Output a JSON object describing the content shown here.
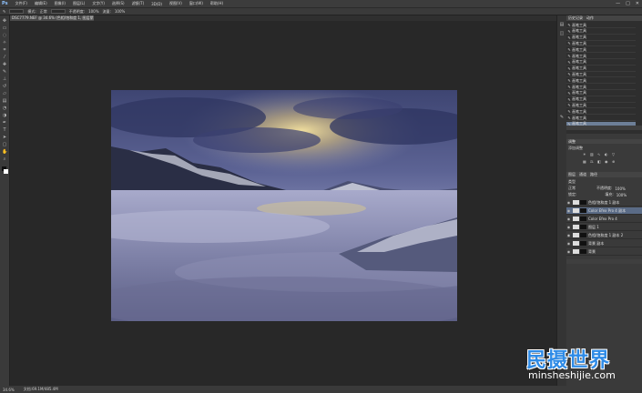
{
  "app": {
    "logo": "Ps",
    "menu": [
      "文件(F)",
      "编辑(E)",
      "图像(I)",
      "图层(L)",
      "文字(Y)",
      "选择(S)",
      "滤镜(T)",
      "3D(D)",
      "视图(V)",
      "窗口(W)",
      "帮助(H)"
    ],
    "window_controls": [
      "—",
      "□",
      "✕"
    ]
  },
  "options_bar": {
    "mode_label": "模式:",
    "mode_value": "正常",
    "opacity_label": "不透明度:",
    "opacity_value": "100%",
    "flow_label": "流量:",
    "flow_value": "100%"
  },
  "document_tab": {
    "title": "DSC7779.NEF @ 34.6% (色相/饱和度 1, 图层蒙版/8) *"
  },
  "history_panel": {
    "tabs": [
      "历史记录",
      "动作"
    ],
    "items": [
      "画笔工具",
      "画笔工具",
      "画笔工具",
      "画笔工具",
      "画笔工具",
      "画笔工具",
      "画笔工具",
      "画笔工具",
      "画笔工具",
      "画笔工具",
      "画笔工具",
      "画笔工具",
      "画笔工具",
      "画笔工具",
      "画笔工具",
      "画笔工具",
      "画笔工具"
    ]
  },
  "adjustments_panel": {
    "title": "调整",
    "subtitle": "添加调整"
  },
  "layers_panel": {
    "tabs": [
      "图层",
      "通道",
      "路径"
    ],
    "kind_label": "类型",
    "blend_value": "正常",
    "opacity_label": "不透明度:",
    "opacity_value": "100%",
    "lock_label": "锁定:",
    "fill_label": "填充:",
    "fill_value": "100%",
    "layers": [
      {
        "name": "色相/饱和度 1 副本",
        "active": false
      },
      {
        "name": "Color Efex Pro 4 副本",
        "active": true
      },
      {
        "name": "Color Efex Pro 4",
        "active": false
      },
      {
        "name": "图层 1",
        "active": false
      },
      {
        "name": "色相/饱和度 1 副本 2",
        "active": false
      },
      {
        "name": "背景 副本",
        "active": false
      },
      {
        "name": "背景",
        "active": false
      }
    ]
  },
  "status_bar": {
    "zoom": "34.6%",
    "doc_size": "文档:69.1M/485.4M"
  },
  "watermark": {
    "cn": "民摄世界",
    "en": "minsheshijie.com"
  },
  "colors": {
    "accent": "#2f8be6",
    "active_row": "#5a6b86",
    "panel_bg": "#3a3a3a",
    "canvas_bg": "#282828"
  }
}
